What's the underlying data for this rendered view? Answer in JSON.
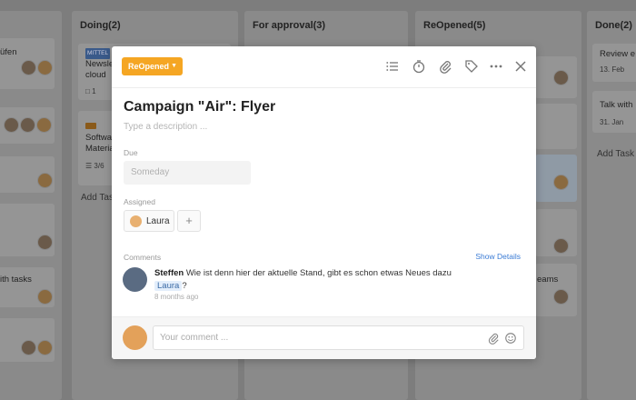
{
  "board": {
    "col0": {
      "card_texts": [
        "üfen",
        "ith tasks"
      ]
    },
    "col1": {
      "title": "Doing(2)",
      "cards": [
        {
          "tag": "MITTEL",
          "text": "Newsle\ncloud",
          "meta": "1"
        },
        {
          "text": "Softwa\nMateria",
          "meta": "3/6"
        }
      ],
      "add_task": "Add Task"
    },
    "col2": {
      "title": "For approval(3)"
    },
    "col3": {
      "title": "ReOpened(5)",
      "card_text": "eams"
    },
    "col4": {
      "title": "Done(2)",
      "cards": [
        {
          "text": "Review e",
          "meta": "13. Feb"
        },
        {
          "text": "Talk with",
          "meta": "31. Jan"
        }
      ],
      "add_task": "Add Task"
    }
  },
  "modal": {
    "status": "ReOpened",
    "status_color": "#f5a623",
    "toolbar_icons": [
      "checklist-icon",
      "stopwatch-icon",
      "paperclip-icon",
      "tag-icon",
      "more-icon",
      "close-icon"
    ],
    "title": "Campaign \"Air\": Flyer",
    "description_placeholder": "Type a description ...",
    "due_label": "Due",
    "due_value": "Someday",
    "assigned_label": "Assigned",
    "assignee": "Laura",
    "comments_label": "Comments",
    "show_details": "Show Details",
    "comment": {
      "author": "Steffen",
      "text": "Wie ist denn hier der aktuelle Stand, gibt es schon etwas Neues dazu",
      "mention": "Laura",
      "suffix": "?",
      "time": "8 months ago"
    },
    "comment_placeholder": "Your comment ..."
  }
}
